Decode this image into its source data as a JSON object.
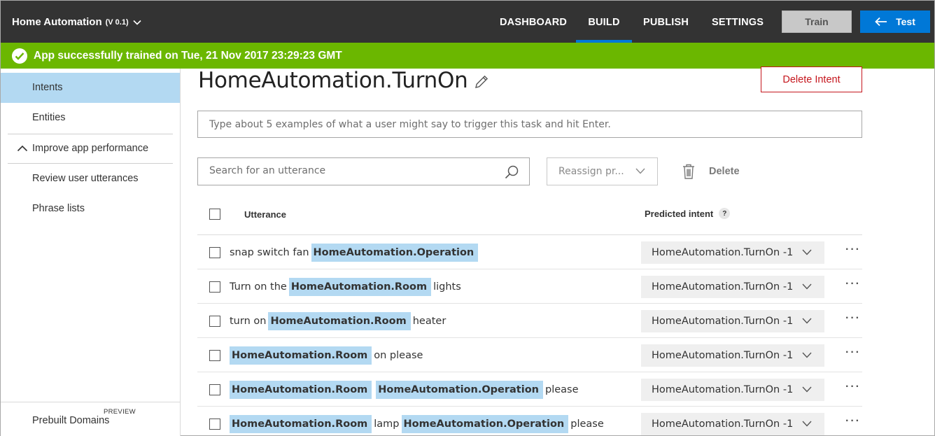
{
  "header": {
    "app_name": "Home Automation",
    "version": "(V 0.1)",
    "nav": [
      "DASHBOARD",
      "BUILD",
      "PUBLISH",
      "SETTINGS"
    ],
    "active_nav": "BUILD",
    "train_label": "Train",
    "test_label": "Test"
  },
  "banner": {
    "message": "App successfully trained on Tue, 21 Nov 2017 23:29:23 GMT",
    "color": "#6bb700"
  },
  "sidebar": {
    "items": [
      {
        "label": "Intents",
        "active": true
      },
      {
        "label": "Entities",
        "active": false
      }
    ],
    "group": {
      "label": "Improve app performance",
      "expanded": true,
      "items": [
        "Review user utterances",
        "Phrase lists"
      ]
    },
    "bottom": {
      "label": "Prebuilt Domains",
      "tag": "PREVIEW"
    }
  },
  "main": {
    "title": "HomeAutomation.TurnOn",
    "delete_intent_label": "Delete Intent",
    "utterance_placeholder": "Type about 5 examples of what a user might say to trigger this task and hit Enter.",
    "search_placeholder": "Search for an utterance",
    "reassign_label": "Reassign pr...",
    "delete_label": "Delete",
    "columns": {
      "utterance": "Utterance",
      "predicted": "Predicted intent",
      "help": "?"
    },
    "rows": [
      {
        "tokens": [
          {
            "t": "snap switch fan",
            "e": false
          },
          {
            "t": "HomeAutomation.Operation",
            "e": true
          }
        ],
        "predicted": "HomeAutomation.TurnOn -1"
      },
      {
        "tokens": [
          {
            "t": "Turn on the",
            "e": false
          },
          {
            "t": "HomeAutomation.Room",
            "e": true
          },
          {
            "t": "lights",
            "e": false
          }
        ],
        "predicted": "HomeAutomation.TurnOn -1"
      },
      {
        "tokens": [
          {
            "t": "turn on",
            "e": false
          },
          {
            "t": "HomeAutomation.Room",
            "e": true
          },
          {
            "t": "heater",
            "e": false
          }
        ],
        "predicted": "HomeAutomation.TurnOn -1"
      },
      {
        "tokens": [
          {
            "t": "HomeAutomation.Room",
            "e": true
          },
          {
            "t": "on please",
            "e": false
          }
        ],
        "predicted": "HomeAutomation.TurnOn -1"
      },
      {
        "tokens": [
          {
            "t": "HomeAutomation.Room",
            "e": true
          },
          {
            "t": "HomeAutomation.Operation",
            "e": true
          },
          {
            "t": "please",
            "e": false
          }
        ],
        "predicted": "HomeAutomation.TurnOn -1"
      },
      {
        "tokens": [
          {
            "t": "HomeAutomation.Room",
            "e": true
          },
          {
            "t": "lamp",
            "e": false
          },
          {
            "t": "HomeAutomation.Operation",
            "e": true
          },
          {
            "t": "please",
            "e": false
          }
        ],
        "predicted": "HomeAutomation.TurnOn -1"
      }
    ],
    "more_icon": "···"
  },
  "colors": {
    "topbar": "#333333",
    "accent": "#0078d7",
    "entity_highlight": "#b3d9f2",
    "danger": "#c5161d"
  }
}
